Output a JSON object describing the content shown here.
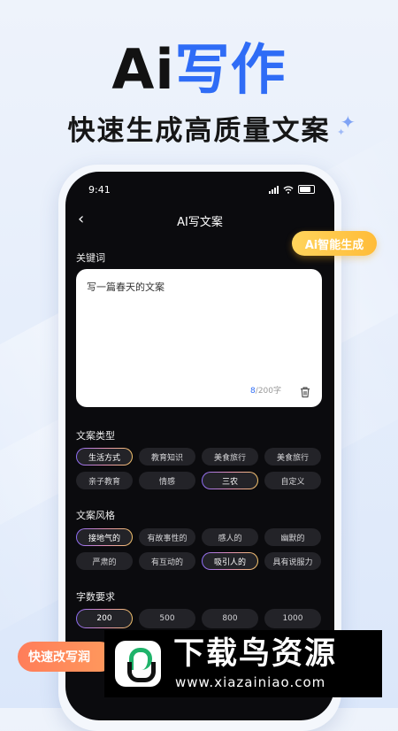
{
  "hero": {
    "title_ai": "Ai",
    "title_xz": "写作",
    "subtitle": "快速生成高质量文案"
  },
  "status_bar": {
    "time": "9:41"
  },
  "nav": {
    "title": "AI写文案",
    "back_icon": "chevron-left-icon"
  },
  "keyword": {
    "label": "关键词",
    "value": "写一篇春天的文案",
    "count_current": "8",
    "count_max": "/200字"
  },
  "copy_type": {
    "label": "文案类型",
    "rows": [
      [
        {
          "label": "生活方式",
          "selected": true
        },
        {
          "label": "教育知识",
          "selected": false
        },
        {
          "label": "美食旅行",
          "selected": false
        },
        {
          "label": "美食旅行",
          "selected": false
        }
      ],
      [
        {
          "label": "亲子教育",
          "selected": false
        },
        {
          "label": "情感",
          "selected": false
        },
        {
          "label": "三农",
          "selected": true
        },
        {
          "label": "自定义",
          "selected": false
        }
      ]
    ]
  },
  "copy_style": {
    "label": "文案风格",
    "rows": [
      [
        {
          "label": "接地气的",
          "selected": true
        },
        {
          "label": "有故事性的",
          "selected": false
        },
        {
          "label": "感人的",
          "selected": false
        },
        {
          "label": "幽默的",
          "selected": false
        }
      ],
      [
        {
          "label": "严肃的",
          "selected": false
        },
        {
          "label": "有互动的",
          "selected": false
        },
        {
          "label": "吸引人的",
          "selected": true
        },
        {
          "label": "具有说服力",
          "selected": false
        }
      ]
    ]
  },
  "word_count": {
    "label": "字数要求",
    "options": [
      {
        "label": "200",
        "selected": true
      },
      {
        "label": "500",
        "selected": false
      },
      {
        "label": "800",
        "selected": false
      },
      {
        "label": "1000",
        "selected": false
      }
    ]
  },
  "badges": {
    "ai_generate": "Ai智能生成",
    "rewrite": "快速改写润"
  },
  "watermark": {
    "title": "下载鸟资源",
    "url": "www.xiazainiao.com"
  },
  "colors": {
    "accent": "#2f6cf6",
    "phone_bg": "#0b0b0e",
    "chip_bg": "#232328",
    "badge_yellow": "#ffc640",
    "badge_orange": "#ff8a5a"
  }
}
